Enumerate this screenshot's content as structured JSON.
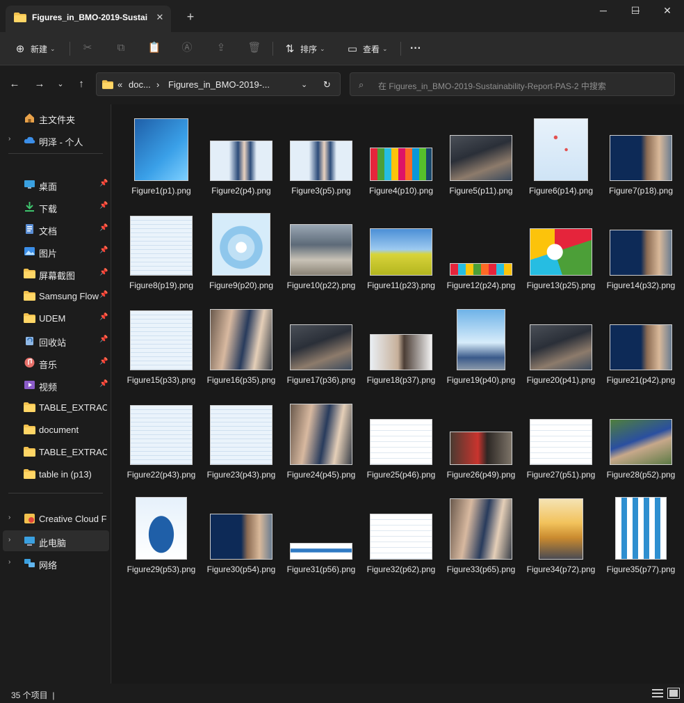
{
  "window": {
    "tab_title": "Figures_in_BMO-2019-Sustain",
    "tab_close": "✕",
    "new_tab": "+",
    "minimize": "─",
    "maximize": "☐",
    "close": "✕"
  },
  "toolbar": {
    "new_label": "新建",
    "sort_label": "排序",
    "view_label": "查看",
    "more_label": "···"
  },
  "address": {
    "overflow": "«",
    "crumb1": "doc...",
    "sep": "›",
    "crumb2": "Figures_in_BMO-2019-...",
    "search_placeholder": "在 Figures_in_BMO-2019-Sustainability-Report-PAS-2 中搜索"
  },
  "sidebar": {
    "items": [
      {
        "label": "主文件夹",
        "icon": "home-icon",
        "chevron": false,
        "pin": false
      },
      {
        "label": "明泽 - 个人",
        "icon": "cloud-icon",
        "chevron": true,
        "pin": false
      },
      {
        "label": "桌面",
        "icon": "desktop-icon",
        "chevron": false,
        "pin": true
      },
      {
        "label": "下载",
        "icon": "download-icon",
        "chevron": false,
        "pin": true
      },
      {
        "label": "文档",
        "icon": "document-icon",
        "chevron": false,
        "pin": true
      },
      {
        "label": "图片",
        "icon": "pictures-icon",
        "chevron": false,
        "pin": true
      },
      {
        "label": "屏幕截图",
        "icon": "folder-icon",
        "chevron": false,
        "pin": true
      },
      {
        "label": "Samsung Flow",
        "icon": "folder-icon",
        "chevron": false,
        "pin": true
      },
      {
        "label": "UDEM",
        "icon": "folder-icon",
        "chevron": false,
        "pin": true
      },
      {
        "label": "回收站",
        "icon": "recycle-bin-icon",
        "chevron": false,
        "pin": true
      },
      {
        "label": "音乐",
        "icon": "music-icon",
        "chevron": false,
        "pin": true
      },
      {
        "label": "视频",
        "icon": "video-icon",
        "chevron": false,
        "pin": true
      },
      {
        "label": "TABLE_EXTRACT",
        "icon": "folder-icon",
        "chevron": false,
        "pin": false
      },
      {
        "label": "document",
        "icon": "folder-icon",
        "chevron": false,
        "pin": false
      },
      {
        "label": "TABLE_EXTRACT",
        "icon": "folder-icon",
        "chevron": false,
        "pin": false
      },
      {
        "label": "table in (p13)",
        "icon": "folder-icon",
        "chevron": false,
        "pin": false
      },
      {
        "label": "Creative Cloud Fil",
        "icon": "creative-cloud-icon",
        "chevron": true,
        "pin": false
      },
      {
        "label": "此电脑",
        "icon": "this-pc-icon",
        "chevron": true,
        "pin": false,
        "active": true
      },
      {
        "label": "网络",
        "icon": "network-icon",
        "chevron": true,
        "pin": false
      }
    ]
  },
  "files": [
    {
      "name": "Figure1(p1).png",
      "thumb": "blue-cover"
    },
    {
      "name": "Figure2(p4).png",
      "thumb": "portrait"
    },
    {
      "name": "Figure3(p5).png",
      "thumb": "portrait"
    },
    {
      "name": "Figure4(p10).png",
      "thumb": "sdg-grid"
    },
    {
      "name": "Figure5(p11).png",
      "thumb": "photo-dark"
    },
    {
      "name": "Figure6(p14).png",
      "thumb": "map-light"
    },
    {
      "name": "Figure7(p18).png",
      "thumb": "navy-photo"
    },
    {
      "name": "Figure8(p19).png",
      "thumb": "text-page"
    },
    {
      "name": "Figure9(p20).png",
      "thumb": "circles"
    },
    {
      "name": "Figure10(p22).png",
      "thumb": "building"
    },
    {
      "name": "Figure11(p23).png",
      "thumb": "field"
    },
    {
      "name": "Figure12(p24).png",
      "thumb": "sdg-strip"
    },
    {
      "name": "Figure13(p25).png",
      "thumb": "donut"
    },
    {
      "name": "Figure14(p32).png",
      "thumb": "navy-photo"
    },
    {
      "name": "Figure15(p33).png",
      "thumb": "text-page"
    },
    {
      "name": "Figure16(p35).png",
      "thumb": "people"
    },
    {
      "name": "Figure17(p36).png",
      "thumb": "photo-dark"
    },
    {
      "name": "Figure18(p37).png",
      "thumb": "people-light"
    },
    {
      "name": "Figure19(p40).png",
      "thumb": "banner25"
    },
    {
      "name": "Figure20(p41).png",
      "thumb": "photo-dark"
    },
    {
      "name": "Figure21(p42).png",
      "thumb": "navy-photo"
    },
    {
      "name": "Figure22(p43).png",
      "thumb": "text-page"
    },
    {
      "name": "Figure23(p43).png",
      "thumb": "text-page"
    },
    {
      "name": "Figure24(p45).png",
      "thumb": "people"
    },
    {
      "name": "Figure25(p46).png",
      "thumb": "table"
    },
    {
      "name": "Figure26(p49).png",
      "thumb": "people-red"
    },
    {
      "name": "Figure27(p51).png",
      "thumb": "table"
    },
    {
      "name": "Figure28(p52).png",
      "thumb": "outdoor"
    },
    {
      "name": "Figure29(p53).png",
      "thumb": "map-blue"
    },
    {
      "name": "Figure30(p54).png",
      "thumb": "navy-photo"
    },
    {
      "name": "Figure31(p56).png",
      "thumb": "strip-blue"
    },
    {
      "name": "Figure32(p62).png",
      "thumb": "table"
    },
    {
      "name": "Figure33(p65).png",
      "thumb": "people"
    },
    {
      "name": "Figure34(p72).png",
      "thumb": "sunset"
    },
    {
      "name": "Figure35(p77).png",
      "thumb": "bar-chart"
    }
  ],
  "status": {
    "count": "35 个项目",
    "separator": "|"
  }
}
